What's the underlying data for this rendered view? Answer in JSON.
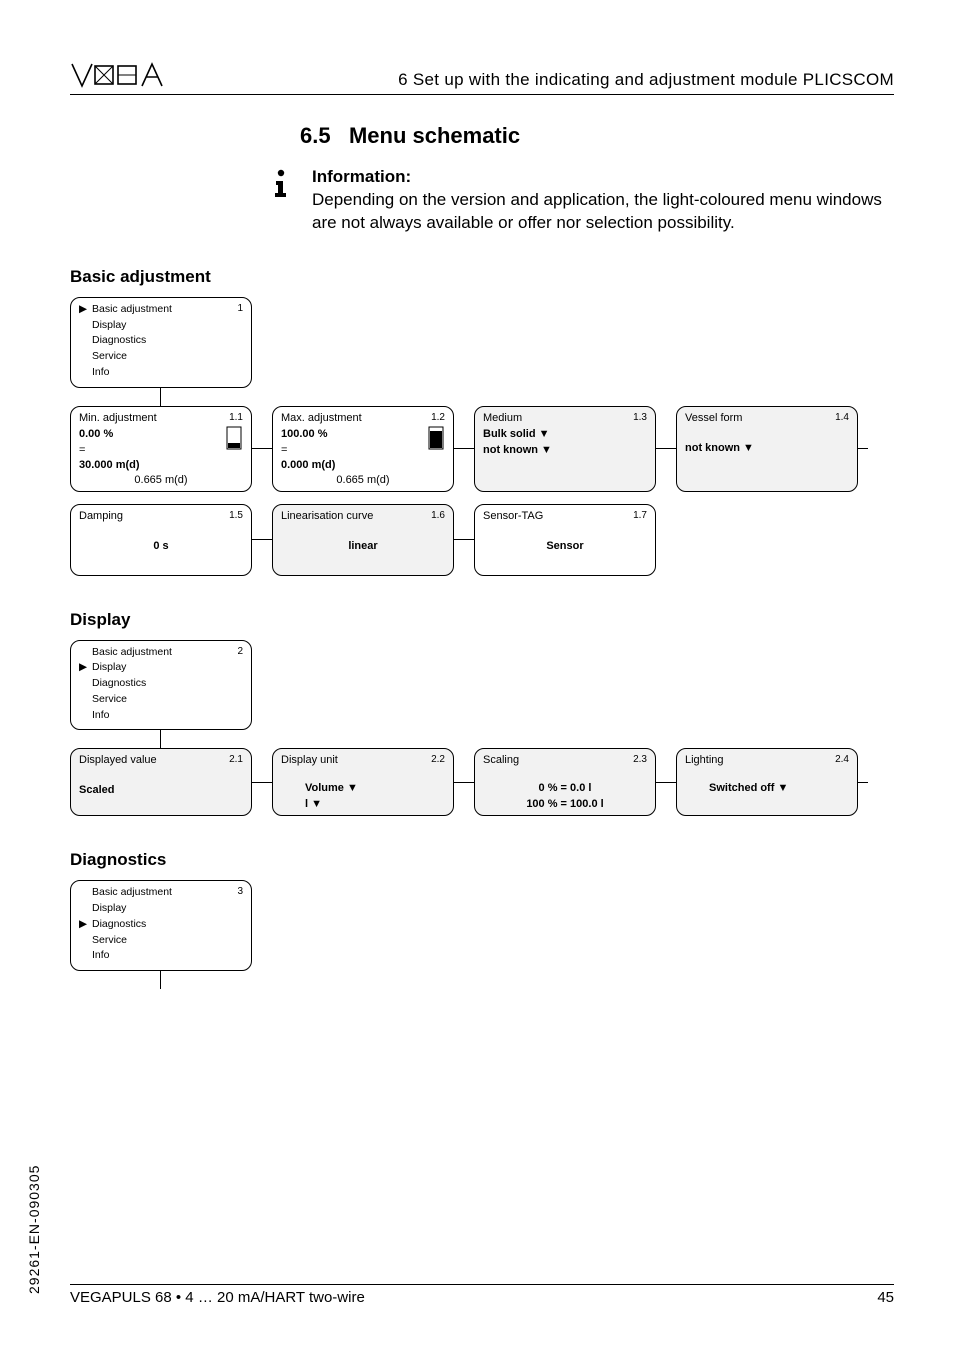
{
  "header_title": "6   Set up with the indicating and adjustment module PLICSCOM",
  "section_number": "6.5",
  "section_name": "Menu schematic",
  "info_heading": "Information:",
  "info_body": "Depending on the version and application, the light-coloured menu windows are not always available or offer nor selection possibility.",
  "groups": {
    "basic": {
      "label": "Basic adjustment",
      "root_num": "1",
      "menu_items": [
        "Basic adjustment",
        "Display",
        "Diagnostics",
        "Service",
        "Info"
      ],
      "selected_index": 0,
      "leaves": [
        {
          "title": "Min. adjustment",
          "num": "1.1",
          "lines": [
            "0.00 %",
            "=",
            "30.000 m(d)"
          ],
          "lines_bold": [
            true,
            false,
            true
          ],
          "sub": "0.665 m(d)",
          "glyph": "tank_min"
        },
        {
          "title": "Max. adjustment",
          "num": "1.2",
          "lines": [
            "100.00 %",
            "=",
            "0.000 m(d)"
          ],
          "lines_bold": [
            true,
            false,
            true
          ],
          "sub": "0.665 m(d)",
          "glyph": "tank_max"
        },
        {
          "title": "Medium",
          "num": "1.3",
          "lines": [
            "Bulk solid ▼",
            "not known ▼"
          ],
          "lines_bold": [
            true,
            true
          ],
          "shaded": true
        },
        {
          "title": "Vessel form",
          "num": "1.4",
          "lines": [
            "not known ▼"
          ],
          "lines_bold": [
            true
          ],
          "lines_mt": true,
          "shaded": true
        }
      ],
      "leaves2": [
        {
          "title": "Damping",
          "num": "1.5",
          "center": "0 s"
        },
        {
          "title": "Linearisation curve",
          "num": "1.6",
          "center": "linear",
          "shaded": true
        },
        {
          "title": "Sensor-TAG",
          "num": "1.7",
          "center": "Sensor"
        }
      ]
    },
    "display": {
      "label": "Display",
      "root_num": "2",
      "menu_items": [
        "Basic adjustment",
        "Display",
        "Diagnostics",
        "Service",
        "Info"
      ],
      "selected_index": 1,
      "leaves": [
        {
          "title": "Displayed value",
          "num": "2.1",
          "lines": [
            "Scaled"
          ],
          "lines_bold": [
            true
          ],
          "lines_mt": true,
          "shaded": true
        },
        {
          "title": "Display unit",
          "num": "2.2",
          "lines": [
            "Volume ▼",
            "l ▼"
          ],
          "lines_bold": [
            true,
            true
          ],
          "indent": true,
          "lines_mt": true,
          "shaded": true
        },
        {
          "title": "Scaling",
          "num": "2.3",
          "lines": [
            "0 % = 0.0 l",
            "100 % = 100.0 l"
          ],
          "lines_bold": [
            true,
            true
          ],
          "center_lines": true,
          "lines_mt": true,
          "shaded": true
        },
        {
          "title": "Lighting",
          "num": "2.4",
          "lines": [
            "Switched off ▼"
          ],
          "lines_bold": [
            true
          ],
          "indent": true,
          "lines_mt": true,
          "shaded": true
        }
      ]
    },
    "diagnostics": {
      "label": "Diagnostics",
      "root_num": "3",
      "menu_items": [
        "Basic adjustment",
        "Display",
        "Diagnostics",
        "Service",
        "Info"
      ],
      "selected_index": 2
    }
  },
  "footer_left": "VEGAPULS 68 • 4 … 20 mA/HART two-wire",
  "footer_right": "45",
  "side_code": "29261-EN-090305"
}
